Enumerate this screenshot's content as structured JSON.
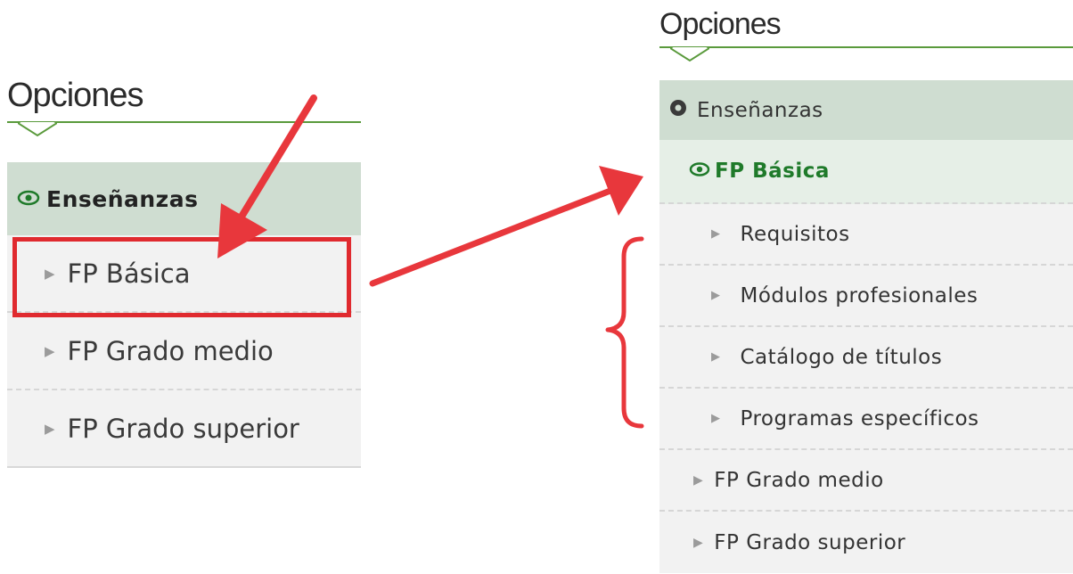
{
  "left_panel": {
    "heading": "Opciones",
    "section_label": "Enseñanzas",
    "items": [
      {
        "label": "FP Básica"
      },
      {
        "label": "FP Grado medio"
      },
      {
        "label": "FP Grado superior"
      }
    ]
  },
  "right_panel": {
    "heading": "Opciones",
    "section_label": "Enseñanzas",
    "active_label": "FP Básica",
    "subitems": [
      {
        "label": "Requisitos"
      },
      {
        "label": "Módulos profesionales"
      },
      {
        "label": "Catálogo de títulos"
      },
      {
        "label": "Programas específicos"
      }
    ],
    "items": [
      {
        "label": "FP Grado medio"
      },
      {
        "label": "FP Grado superior"
      }
    ]
  },
  "icons": {
    "section_left": "eye-icon",
    "section_right": "dark-circle-icon",
    "active": "eye-icon",
    "item": "triangle-right-icon"
  },
  "colors": {
    "accent_green": "#1f7a2a",
    "section_bg": "#cfddd1",
    "annotation_red": "#e02a2f"
  }
}
